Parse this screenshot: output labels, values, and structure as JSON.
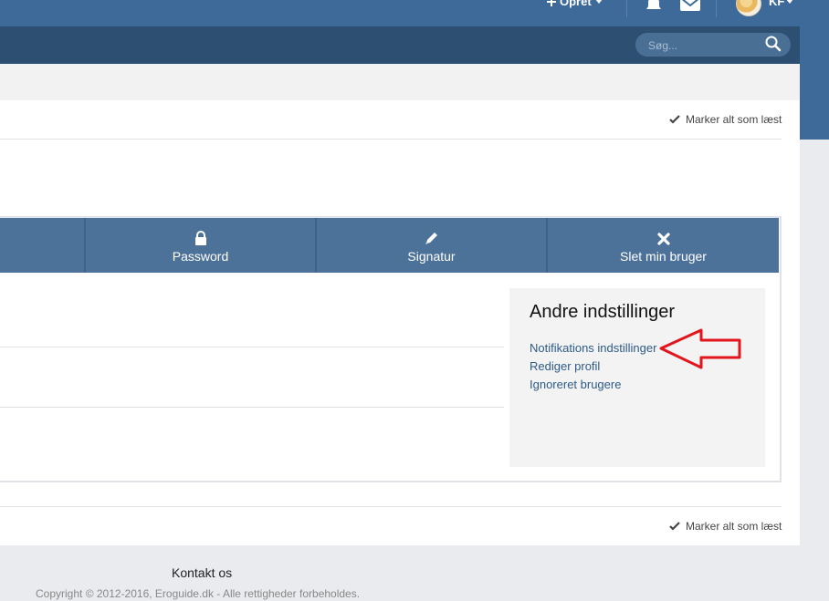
{
  "header": {
    "create_label": "Opret",
    "user_initials": "KF",
    "icons": [
      "plus-icon",
      "bell-icon",
      "mail-icon",
      "avatar"
    ]
  },
  "search": {
    "placeholder": "Søg..."
  },
  "mark_all_read": "Marker alt som læst",
  "tabs": [
    {
      "label": "Password",
      "icon": "lock-icon"
    },
    {
      "label": "Signatur",
      "icon": "pencil-icon"
    },
    {
      "label": "Slet min bruger",
      "icon": "close-icon"
    }
  ],
  "sidebar": {
    "title": "Andre indstillinger",
    "links": [
      {
        "label": "Notifikations indstillinger"
      },
      {
        "label": "Rediger profil"
      },
      {
        "label": "Ignoreret brugere"
      }
    ]
  },
  "footer": {
    "contact": "Kontakt os",
    "copyright": "Copyright © 2012-2016, Eroguide.dk - Alle rettigheder forbeholdes."
  },
  "colors": {
    "header_bg": "#3d6a99",
    "nav_bg": "#2c4f72",
    "tab_bg": "#4d729a",
    "link": "#2d5b89",
    "annotation_arrow": "#e2141c"
  }
}
